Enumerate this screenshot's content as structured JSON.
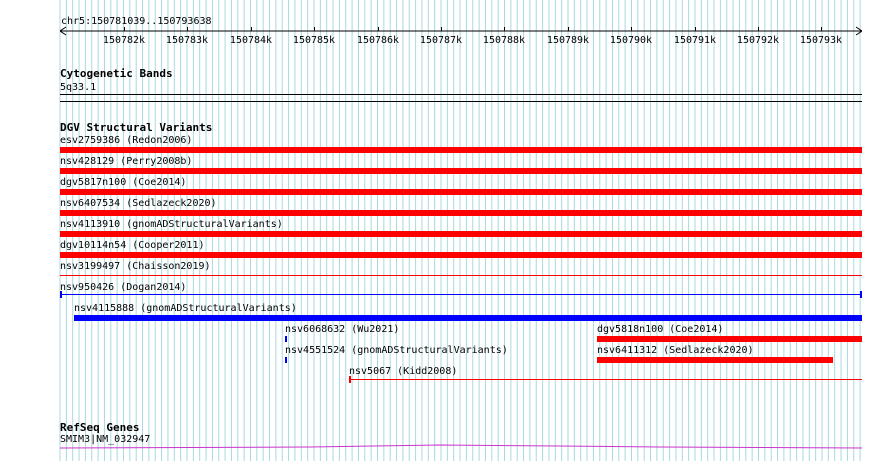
{
  "ruler": {
    "locus": "chr5:150781039..150793638",
    "ticks": [
      "150782k",
      "150783k",
      "150784k",
      "150785k",
      "150786k",
      "150787k",
      "150788k",
      "150789k",
      "150790k",
      "150791k",
      "150792k",
      "150793k"
    ]
  },
  "cyto": {
    "title": "Cytogenetic Bands",
    "band": "5q33.1"
  },
  "dgv": {
    "title": "DGV Structural Variants",
    "features": [
      {
        "label": "esv2759386 (Redon2006)",
        "color": "#ff0000"
      },
      {
        "label": "nsv428129 (Perry2008b)",
        "color": "#ff0000"
      },
      {
        "label": "dgv5817n100 (Coe2014)",
        "color": "#ff0000"
      },
      {
        "label": "nsv6407534 (Sedlazeck2020)",
        "color": "#ff0000"
      },
      {
        "label": "nsv4113910 (gnomADStructuralVariants)",
        "color": "#ff0000"
      },
      {
        "label": "dgv10114n54 (Cooper2011)",
        "color": "#ff0000"
      },
      {
        "label": "nsv3199497 (Chaisson2019)",
        "color": "#ff0000"
      },
      {
        "label": "nsv950426 (Dogan2014)",
        "color": "#0000ff"
      },
      {
        "label": "nsv4115888 (gnomADStructuralVariants)",
        "color": "#0000ff"
      },
      {
        "label": "nsv6068632 (Wu2021)",
        "color": "#0000ff"
      },
      {
        "label": "nsv4551524 (gnomADStructuralVariants)",
        "color": "#0000ff"
      },
      {
        "label": "dgv5818n100 (Coe2014)",
        "color": "#ff0000"
      },
      {
        "label": "nsv6411312 (Sedlazeck2020)",
        "color": "#ff0000"
      },
      {
        "label": "nsv5067 (Kidd2008)",
        "color": "#ff0000"
      }
    ]
  },
  "refseq": {
    "title": "RefSeq Genes",
    "genes": [
      {
        "label": "SMIM3|NM_032947",
        "color": "#cc33cc"
      }
    ]
  },
  "colors": {
    "grid": "#a8d8e0",
    "deletion": "#ff0000",
    "gain": "#0000ff",
    "gene": "#cc33cc"
  }
}
